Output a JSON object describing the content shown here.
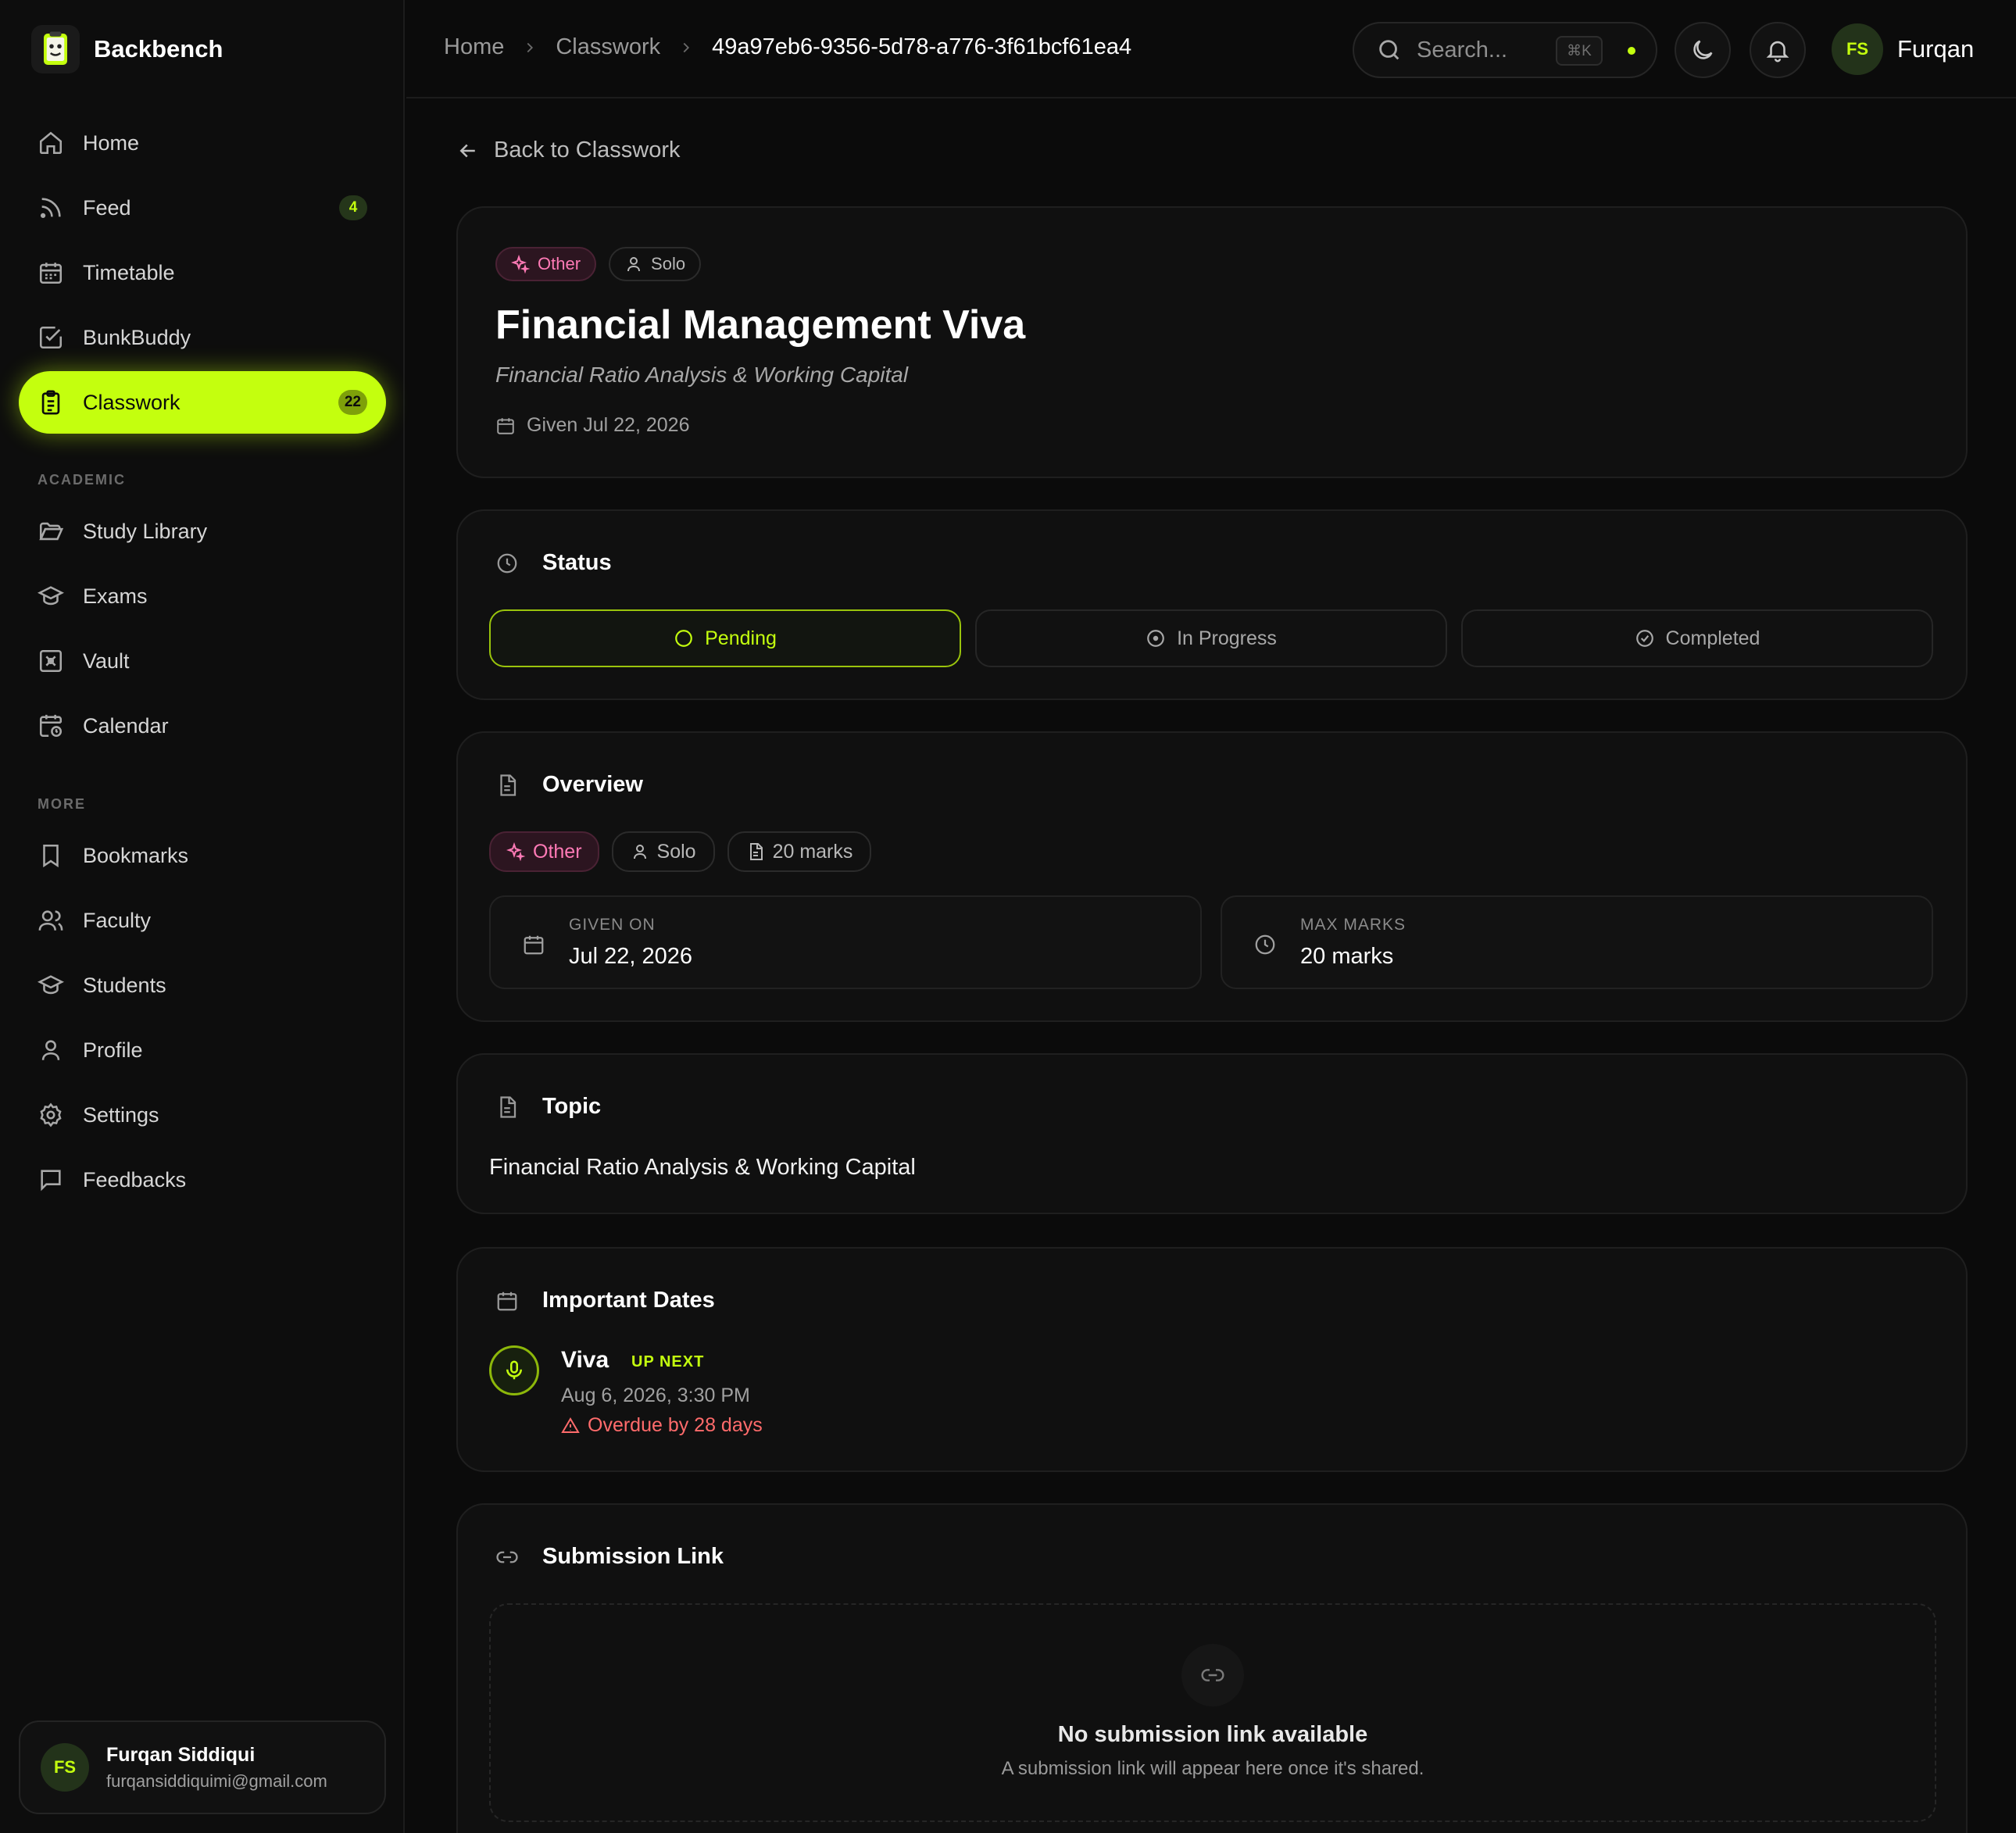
{
  "app": {
    "name": "Backbench"
  },
  "colors": {
    "accent": "#c4ff0e",
    "background": "#0b0b0b",
    "pink": "#ff7ab6",
    "danger": "#ff6b6b"
  },
  "sidebar": {
    "items": [
      {
        "label": "Home",
        "icon": "home-icon"
      },
      {
        "label": "Feed",
        "icon": "rss-icon",
        "badge": "4"
      },
      {
        "label": "Timetable",
        "icon": "calendar-grid-icon"
      },
      {
        "label": "BunkBuddy",
        "icon": "check-square-icon"
      },
      {
        "label": "Classwork",
        "icon": "clipboard-icon",
        "badge": "22",
        "active": true
      }
    ],
    "academic_label": "ACADEMIC",
    "academic": [
      {
        "label": "Study Library",
        "icon": "folder-open-icon"
      },
      {
        "label": "Exams",
        "icon": "graduation-cap-icon"
      },
      {
        "label": "Vault",
        "icon": "vault-icon"
      },
      {
        "label": "Calendar",
        "icon": "calendar-clock-icon"
      }
    ],
    "more_label": "MORE",
    "more": [
      {
        "label": "Bookmarks",
        "icon": "bookmark-icon"
      },
      {
        "label": "Faculty",
        "icon": "users-icon"
      },
      {
        "label": "Students",
        "icon": "graduation-cap-icon"
      },
      {
        "label": "Profile",
        "icon": "user-icon"
      },
      {
        "label": "Settings",
        "icon": "gear-icon"
      },
      {
        "label": "Feedbacks",
        "icon": "message-square-icon"
      }
    ],
    "user": {
      "initials": "FS",
      "name": "Furqan Siddiqui",
      "email": "furqansiddiquimi@gmail.com"
    }
  },
  "topbar": {
    "breadcrumbs": [
      "Home",
      "Classwork",
      "49a97eb6-9356-5d78-a776-3f61bcf61ea4"
    ],
    "search_placeholder": "Search...",
    "search_shortcut": "⌘K",
    "user_initials": "FS",
    "user_name": "Furqan"
  },
  "main": {
    "back_label": "Back to Classwork",
    "header": {
      "category": "Other",
      "mode": "Solo",
      "title": "Financial Management Viva",
      "subtitle": "Financial Ratio Analysis & Working Capital",
      "given": "Given Jul 22, 2026"
    },
    "status": {
      "title": "Status",
      "options": [
        "Pending",
        "In Progress",
        "Completed"
      ],
      "selected": "Pending"
    },
    "overview": {
      "title": "Overview",
      "category": "Other",
      "mode": "Solo",
      "marks_pill": "20 marks",
      "given_label": "GIVEN ON",
      "given_value": "Jul 22, 2026",
      "max_label": "MAX MARKS",
      "max_value": "20 marks"
    },
    "topic": {
      "title": "Topic",
      "text": "Financial Ratio Analysis & Working Capital"
    },
    "dates": {
      "title": "Important Dates",
      "event_name": "Viva",
      "event_tag": "UP NEXT",
      "event_date": "Aug 6, 2026, 3:30 PM",
      "overdue": "Overdue by 28 days"
    },
    "submission": {
      "title": "Submission Link",
      "empty_title": "No submission link available",
      "empty_sub": "A submission link will appear here once it's shared."
    }
  }
}
